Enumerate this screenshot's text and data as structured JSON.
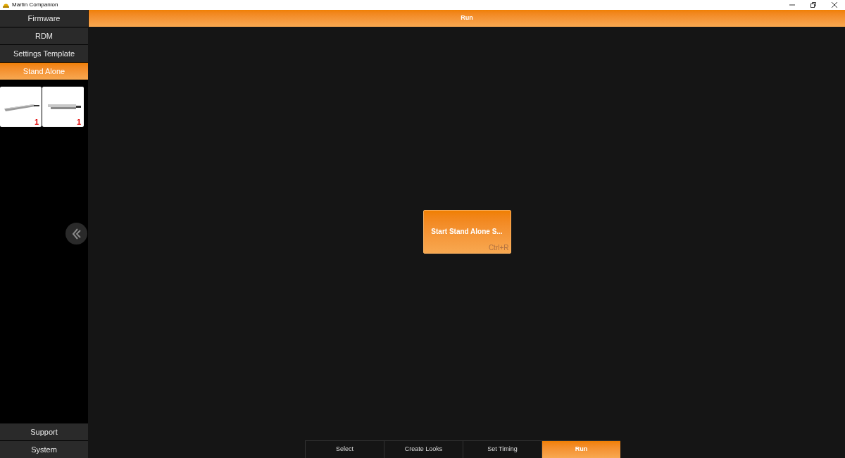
{
  "window": {
    "title": "Martin Companion"
  },
  "sidebar": {
    "items": [
      {
        "label": "Firmware",
        "selected": false
      },
      {
        "label": "RDM",
        "selected": false
      },
      {
        "label": "Settings Template",
        "selected": false
      },
      {
        "label": "Stand Alone",
        "selected": true
      }
    ],
    "fixtures": [
      {
        "count": "1"
      },
      {
        "count": "1"
      }
    ],
    "bottom_items": [
      {
        "label": "Support"
      },
      {
        "label": "System"
      }
    ]
  },
  "header": {
    "title": "Run"
  },
  "action": {
    "label": "Start Stand Alone S...",
    "shortcut": "Ctrl+R"
  },
  "steps": [
    {
      "label": "Select",
      "selected": false
    },
    {
      "label": "Create Looks",
      "selected": false
    },
    {
      "label": "Set Timing",
      "selected": false
    },
    {
      "label": "Run",
      "selected": true
    }
  ]
}
